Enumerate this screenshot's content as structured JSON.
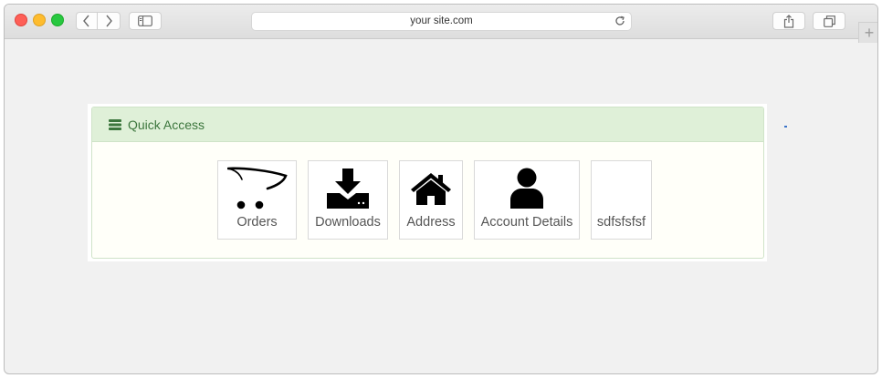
{
  "browser": {
    "address": "your site.com"
  },
  "panel": {
    "title": "Quick Access"
  },
  "tiles": [
    {
      "label": "Orders",
      "icon": "cart-icon"
    },
    {
      "label": "Downloads",
      "icon": "download-icon"
    },
    {
      "label": "Address",
      "icon": "home-icon"
    },
    {
      "label": "Account Details",
      "icon": "user-icon"
    },
    {
      "label": "sdfsfsfsf",
      "icon": ""
    }
  ],
  "colors": {
    "panel_heading_bg": "#dff0d8",
    "panel_heading_text": "#3c763d"
  }
}
